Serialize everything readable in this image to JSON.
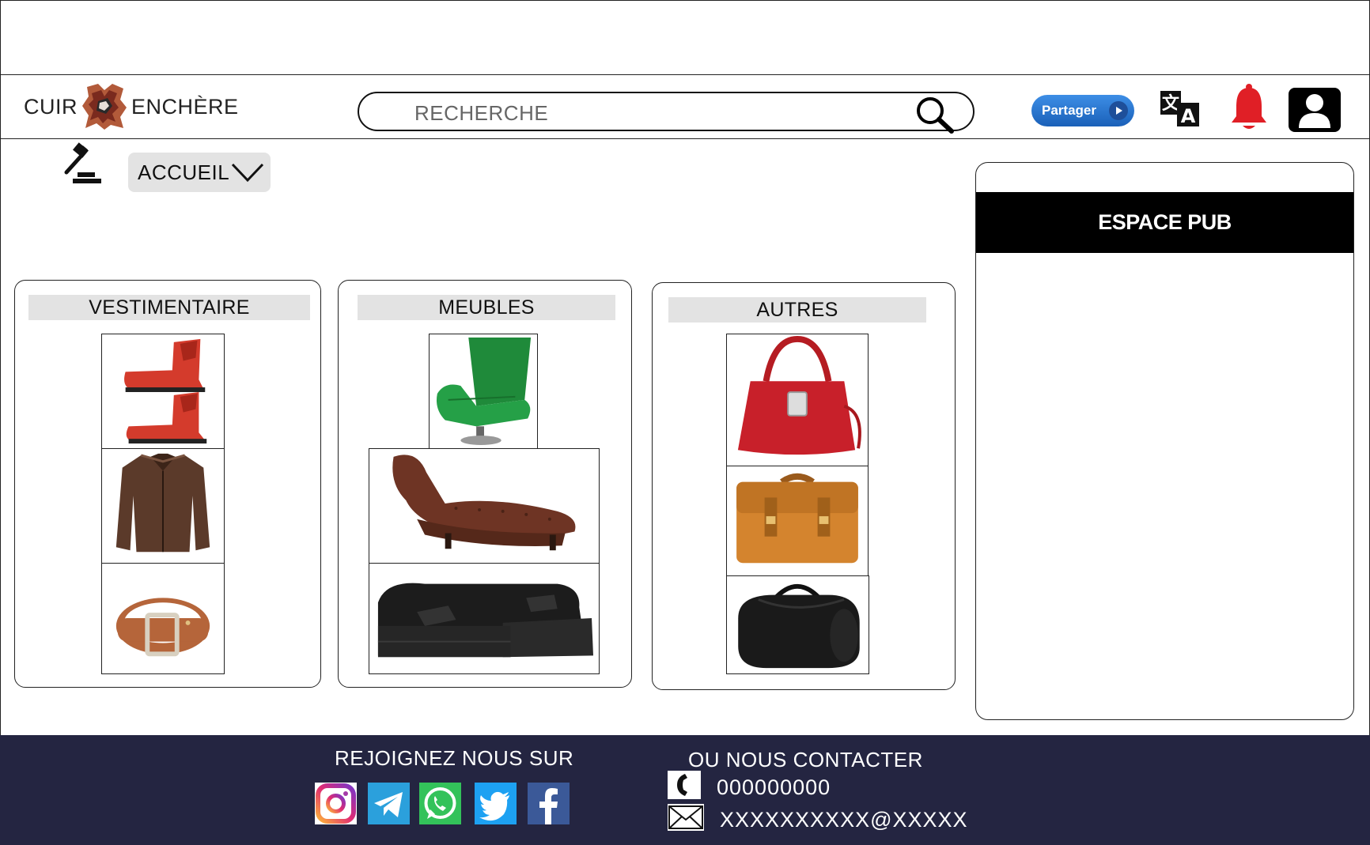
{
  "header": {
    "logo_left": "CUIR",
    "logo_right": "ENCHÈRE",
    "search_placeholder": "RECHERCHE",
    "share_label": "Partager"
  },
  "nav": {
    "home_label": "ACCUEIL"
  },
  "categories": [
    {
      "title": "VESTIMENTAIRE",
      "products": [
        "red-boots-image",
        "leather-jacket-image",
        "leather-belt-image"
      ]
    },
    {
      "title": "MEUBLES",
      "products": [
        "green-armchair-image",
        "leather-chaise-longue-image",
        "black-corner-sofa-image"
      ]
    },
    {
      "title": "AUTRES",
      "products": [
        "red-handbag-image",
        "brown-briefcase-image",
        "black-duffel-bag-image"
      ]
    }
  ],
  "ad": {
    "label": "ESPACE PUB"
  },
  "footer": {
    "join_title": "REJOIGNEZ NOUS SUR",
    "contact_title": "OU NOUS CONTACTER",
    "phone": "000000000",
    "email": "XXXXXXXXXX@XXXXX",
    "socials": [
      "instagram-icon",
      "telegram-icon",
      "whatsapp-icon",
      "twitter-icon",
      "facebook-icon"
    ]
  },
  "colors": {
    "footer_bg": "#242541",
    "share_blue": "#1a60b8",
    "bell_red": "#e01f26",
    "tab_gray": "#e3e3e3"
  }
}
